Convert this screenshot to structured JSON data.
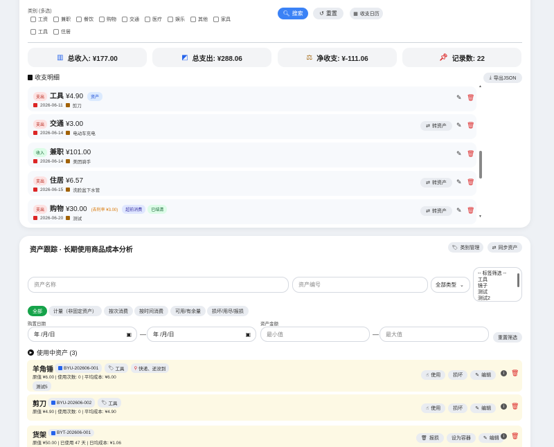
{
  "filters": {
    "category_label": "类别 (多选)",
    "categories": [
      "工资",
      "兼职",
      "餐饮",
      "购物",
      "交通",
      "医疗",
      "娱乐",
      "其他",
      "家具",
      "工具",
      "住居"
    ],
    "search_btn": "搜索",
    "reset_btn": "重置",
    "calendar_btn": "收支日历"
  },
  "stats": {
    "income": "总收入: ¥177.00",
    "expense": "总支出: ¥288.06",
    "net": "净收支: ¥-111.06",
    "count": "记录数: 22"
  },
  "ledger": {
    "title": "收支明细",
    "export_btn": "导出JSON",
    "transfer_label": "转资产",
    "records": [
      {
        "type": "支出",
        "kind": "exp",
        "category": "工具",
        "amount": "¥4.90",
        "date": "2026-06-11",
        "note": "剪刀",
        "extra": "资产",
        "transfer": false
      },
      {
        "type": "支出",
        "kind": "exp",
        "category": "交通",
        "amount": "¥3.00",
        "date": "2026-06-14",
        "note": "电动车充电",
        "transfer": true
      },
      {
        "type": "收入",
        "kind": "inc",
        "category": "兼职",
        "amount": "¥101.00",
        "date": "2026-06-14",
        "note": "美团骑手",
        "transfer": false
      },
      {
        "type": "支出",
        "kind": "exp",
        "category": "住居",
        "amount": "¥6.57",
        "date": "2026-06-15",
        "note": "洗脸盆下水管",
        "transfer": true
      },
      {
        "type": "支出",
        "kind": "exp",
        "category": "购物",
        "amount": "¥30.00",
        "date": "2026-06-20",
        "note": "测试",
        "remaining": "(去利率 ¥3.00)",
        "chip1": "超前消费",
        "chip2": "已结清",
        "transfer": true
      }
    ]
  },
  "assets": {
    "title": "资产跟踪 · 长期使用商品成本分析",
    "category_mgmt_btn": "类别管理",
    "sync_btn": "同步资产",
    "name_placeholder": "资产名称",
    "code_placeholder": "资产编号",
    "type_select": "全部类型",
    "tag_options": [
      "-- 标签筛选 --",
      "工具",
      "镜子",
      "测试",
      "测试2"
    ],
    "filter_tabs": [
      "全部",
      "计量（非固定资产）",
      "按次消费",
      "按时间消费",
      "可用/有余量",
      "损坏/用尽/报损"
    ],
    "date_label": "购置日期",
    "date_placeholder": "年 /月/日",
    "amount_label": "资产金额",
    "min_placeholder": "最小值",
    "max_placeholder": "最大值",
    "reset_filter_btn": "重置筛选",
    "in_use_heading": "使用中资产 (3)",
    "items": [
      {
        "name": "羊角锤",
        "code": "BYU-202606-001",
        "tag": "工具",
        "note": "快递、还没到",
        "sub": "原值 ¥6.00 | 使用次数: 0 | 平均成本: ¥6.00",
        "tag2": "测试5",
        "buttons": [
          "使用",
          "损坏",
          "编辑"
        ]
      },
      {
        "name": "剪刀",
        "code": "BYU-202606-002",
        "tag": "工具",
        "sub": "原值 ¥4.90 | 使用次数: 0 | 平均成本: ¥4.90",
        "buttons": [
          "使用",
          "损坏",
          "编辑"
        ]
      },
      {
        "name": "货架",
        "code": "BYT-202606-001",
        "sub": "原值 ¥50.00 | 已使用 47 天 | 日均成本: ¥1.06",
        "buttons": [
          "报损",
          "设为容器",
          "编辑"
        ]
      }
    ]
  }
}
